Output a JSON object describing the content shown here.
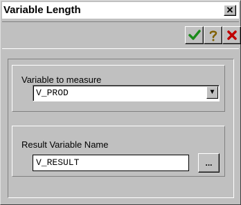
{
  "window": {
    "title": "Variable Length",
    "close_label": "✕"
  },
  "toolbar": {
    "ok_icon": "checkmark-icon",
    "ok_color": "#1a8a1a",
    "help_icon": "question-icon",
    "help_color": "#806000",
    "cancel_icon": "x-icon",
    "cancel_color": "#c00000"
  },
  "measure": {
    "label": "Variable to measure",
    "value": "V_PROD",
    "arrow": "▼"
  },
  "result": {
    "label": "Result Variable Name",
    "value": "V_RESULT",
    "browse_label": "..."
  }
}
